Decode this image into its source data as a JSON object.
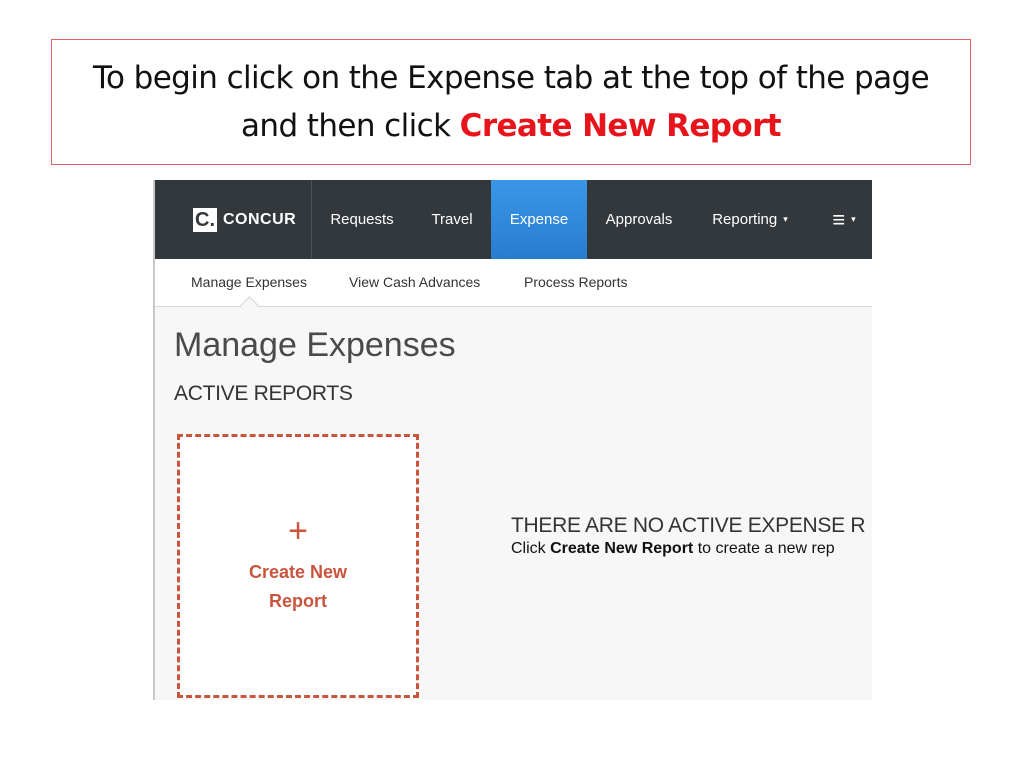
{
  "instruction": {
    "line1": "To begin click on the Expense tab at the top of the page",
    "line2_prefix": "and then click ",
    "line2_highlight": "Create New Report",
    "highlight_color": "#e8141c"
  },
  "app": {
    "logo_mark": "C.",
    "logo_text": "CONCUR",
    "nav": {
      "items": [
        {
          "label": "Requests"
        },
        {
          "label": "Travel"
        },
        {
          "label": "Expense",
          "active": true
        },
        {
          "label": "Approvals"
        },
        {
          "label": "Reporting",
          "caret": "▾"
        },
        {
          "label": "≡",
          "caret": "▾"
        }
      ],
      "active_color": "#2f86d9"
    },
    "subnav": {
      "items": [
        {
          "label": "Manage Expenses",
          "active": true
        },
        {
          "label": "View Cash Advances"
        },
        {
          "label": "Process Reports"
        }
      ]
    },
    "page_title": "Manage Expenses",
    "section_title": "ACTIVE REPORTS",
    "create_card": {
      "icon": "+",
      "label": "Create New Report",
      "accent_color": "#c9553d"
    },
    "empty_state": {
      "heading": "THERE ARE NO ACTIVE EXPENSE R",
      "text_prefix": "Click ",
      "text_bold": "Create New Report",
      "text_suffix": " to create a new rep"
    }
  }
}
